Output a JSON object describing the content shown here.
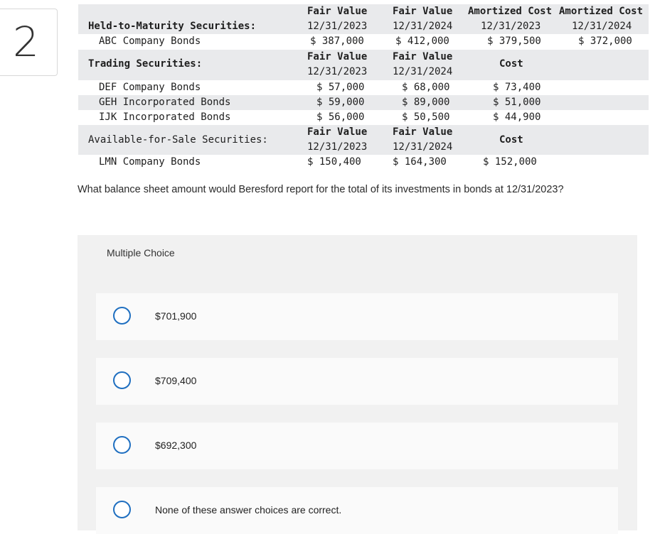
{
  "question_number": "2",
  "table": {
    "htm": {
      "header": {
        "fv1": "Fair Value",
        "fv1_date": "12/31/2023",
        "fv2": "Fair Value",
        "fv2_date": "12/31/2024",
        "c3": "Amortized Cost",
        "c3_date": "12/31/2023",
        "c4": "Amortized Cost",
        "c4_date": "12/31/2024"
      },
      "section_label": "Held-to-Maturity Securities:",
      "rows": [
        {
          "name": "ABC Company Bonds",
          "v1": "$ 387,000",
          "v2": "$ 412,000",
          "v3": "$ 379,500",
          "v4": "$ 372,000"
        }
      ]
    },
    "trading": {
      "header": {
        "fv1": "Fair Value",
        "fv1_date": "12/31/2023",
        "fv2": "Fair Value",
        "fv2_date": "12/31/2024",
        "c3": "Cost"
      },
      "section_label": "Trading Securities:",
      "rows": [
        {
          "name": "DEF Company Bonds",
          "v1": "$ 57,000",
          "v2": "$ 68,000",
          "v3": "$ 73,400"
        },
        {
          "name": "GEH Incorporated Bonds",
          "v1": "$ 59,000",
          "v2": "$ 89,000",
          "v3": "$ 51,000"
        },
        {
          "name": "IJK Incorporated Bonds",
          "v1": "$ 56,000",
          "v2": "$ 50,500",
          "v3": "$ 44,900"
        }
      ]
    },
    "afs": {
      "header": {
        "fv1": "Fair Value",
        "fv1_date": "12/31/2023",
        "fv2": "Fair Value",
        "fv2_date": "12/31/2024",
        "c3": "Cost"
      },
      "section_label": "Available-for-Sale Securities:",
      "rows": [
        {
          "name": "LMN Company Bonds",
          "v1": "$ 150,400",
          "v2": "$ 164,300",
          "v3": "$ 152,000"
        }
      ]
    }
  },
  "question": "What balance sheet amount would Beresford report for the total of its investments in bonds at 12/31/2023?",
  "multiple_choice": {
    "label": "Multiple Choice",
    "choices": [
      {
        "text": "$701,900"
      },
      {
        "text": "$709,400"
      },
      {
        "text": "$692,300"
      },
      {
        "text": "None of these answer choices are correct."
      }
    ]
  },
  "colors": {
    "radio_border": "#1f6fc0",
    "shade": "#e9eaec",
    "panel": "#f1f1f1"
  }
}
